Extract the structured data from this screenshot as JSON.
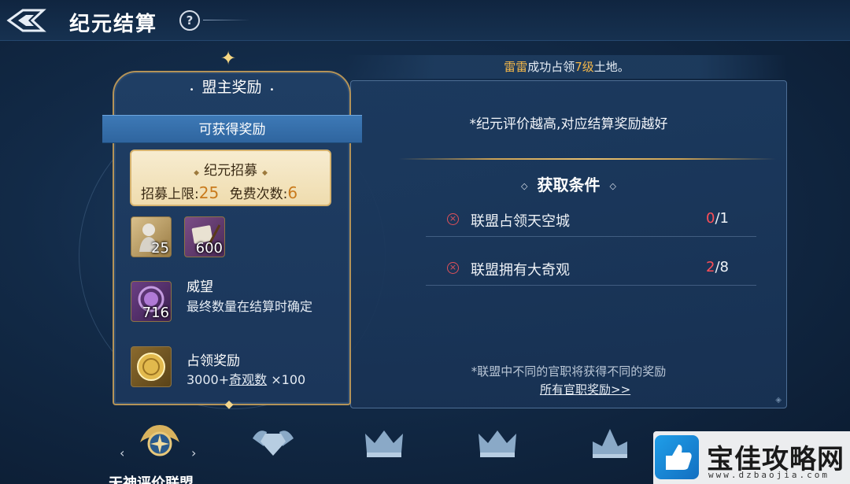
{
  "header": {
    "title": "纪元结算",
    "help_label": "?"
  },
  "result_banner": {
    "name": "雷雷",
    "text_before": "成功占领",
    "level": "7级",
    "text_after": "土地。"
  },
  "left_panel": {
    "title": "盟主奖励",
    "ribbon": "可获得奖励",
    "recruit": {
      "title": "纪元招募",
      "limit_label": "招募上限:",
      "limit_value": "25",
      "free_label": "免费次数:",
      "free_value": "6"
    },
    "items": [
      {
        "icon": "statue-icon",
        "count": "25"
      },
      {
        "icon": "scroll-quill-icon",
        "count": "600"
      }
    ],
    "prestige": {
      "icon": "prestige-medal-icon",
      "count": "716",
      "name": "威望",
      "desc": "最终数量在结算时确定"
    },
    "occupation": {
      "icon": "gold-coin-icon",
      "name": "占领奖励",
      "desc_prefix": "3000+",
      "desc_underlined": "奇观数",
      "desc_suffix": " ×100"
    }
  },
  "right_panel": {
    "tip": "*纪元评价越高,对应结算奖励越好",
    "conditions_title": "获取条件",
    "conditions": [
      {
        "label": "联盟占领天空城",
        "current": "0",
        "total": "/1"
      },
      {
        "label": "联盟拥有大奇观",
        "current": "2",
        "total": "/8"
      }
    ],
    "footnote": "*联盟中不同的官职将获得不同的奖励",
    "link": "所有官职奖励>>"
  },
  "tiers": {
    "selected_label": "天神评价联盟",
    "arrow_left": "‹",
    "arrow_right": "›",
    "icons": [
      "winged-compass-emblem-icon",
      "winged-diamond-icon",
      "crown-icon",
      "crown-icon",
      "crown-icon"
    ]
  },
  "watermark": {
    "text": "宝佳攻略网",
    "url": "www.dzbaojia.com"
  },
  "colors": {
    "gold": "#c9a055",
    "alert_red": "#ff4e57",
    "highlight": "#f5b84a",
    "ribbon_blue": "#3d79b6"
  }
}
